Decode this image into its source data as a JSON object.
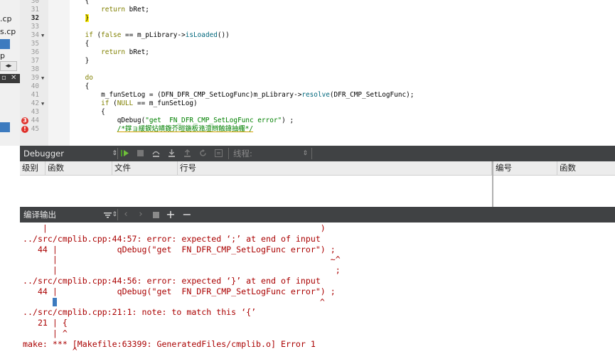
{
  "sidebar": {
    "files": [
      ".cp",
      "s.cp"
    ],
    "item_p": "p",
    "arrow_left": "◂",
    "arrow_right": "▸",
    "close_glyph": "✕"
  },
  "editor": {
    "lines": [
      {
        "n": "30",
        "cur": false,
        "fold": false,
        "err": "",
        "tokens": [
          {
            "c": "plain",
            "t": "    {"
          }
        ]
      },
      {
        "n": "31",
        "cur": false,
        "fold": false,
        "err": "",
        "tokens": [
          {
            "c": "plain",
            "t": "        "
          },
          {
            "c": "kw",
            "t": "return"
          },
          {
            "c": "plain",
            "t": " bRet;"
          }
        ]
      },
      {
        "n": "32",
        "cur": true,
        "fold": false,
        "err": "",
        "tokens": [
          {
            "c": "plain",
            "t": "    "
          },
          {
            "c": "brace-hl",
            "t": "}"
          }
        ]
      },
      {
        "n": "33",
        "cur": false,
        "fold": false,
        "err": "",
        "tokens": []
      },
      {
        "n": "34",
        "cur": false,
        "fold": true,
        "err": "",
        "tokens": [
          {
            "c": "plain",
            "t": "    "
          },
          {
            "c": "kw",
            "t": "if"
          },
          {
            "c": "plain",
            "t": " ("
          },
          {
            "c": "kw",
            "t": "false"
          },
          {
            "c": "plain",
            "t": " == m_pLibrary->"
          },
          {
            "c": "fn",
            "t": "isLoaded"
          },
          {
            "c": "plain",
            "t": "())"
          }
        ]
      },
      {
        "n": "35",
        "cur": false,
        "fold": false,
        "err": "",
        "tokens": [
          {
            "c": "plain",
            "t": "    {"
          }
        ]
      },
      {
        "n": "36",
        "cur": false,
        "fold": false,
        "err": "",
        "tokens": [
          {
            "c": "plain",
            "t": "        "
          },
          {
            "c": "kw",
            "t": "return"
          },
          {
            "c": "plain",
            "t": " bRet;"
          }
        ]
      },
      {
        "n": "37",
        "cur": false,
        "fold": false,
        "err": "",
        "tokens": [
          {
            "c": "plain",
            "t": "    }"
          }
        ]
      },
      {
        "n": "38",
        "cur": false,
        "fold": false,
        "err": "",
        "tokens": []
      },
      {
        "n": "39",
        "cur": false,
        "fold": true,
        "err": "",
        "tokens": [
          {
            "c": "plain",
            "t": "    "
          },
          {
            "c": "kw",
            "t": "do"
          }
        ]
      },
      {
        "n": "40",
        "cur": false,
        "fold": false,
        "err": "",
        "tokens": [
          {
            "c": "plain",
            "t": "    {"
          }
        ]
      },
      {
        "n": "41",
        "cur": false,
        "fold": false,
        "err": "",
        "tokens": [
          {
            "c": "plain",
            "t": "        m_funSetLog = (DFN_DFR_CMP_SetLogFunc)m_pLibrary->"
          },
          {
            "c": "fn",
            "t": "resolve"
          },
          {
            "c": "plain",
            "t": "(DFR_CMP_SetLogFunc);"
          }
        ]
      },
      {
        "n": "42",
        "cur": false,
        "fold": true,
        "err": "",
        "tokens": [
          {
            "c": "plain",
            "t": "        "
          },
          {
            "c": "kw",
            "t": "if"
          },
          {
            "c": "plain",
            "t": " ("
          },
          {
            "c": "kw",
            "t": "NULL"
          },
          {
            "c": "plain",
            "t": " == m_funSetLog)"
          }
        ]
      },
      {
        "n": "43",
        "cur": false,
        "fold": false,
        "err": "",
        "tokens": [
          {
            "c": "plain",
            "t": "        {"
          }
        ]
      },
      {
        "n": "44",
        "cur": false,
        "fold": false,
        "err": "3",
        "tokens": [
          {
            "c": "plain",
            "t": "            qDebug("
          },
          {
            "c": "str",
            "t": "\"get  FN_DFR_CMP_SetLogFunc error\""
          },
          {
            "c": "plain",
            "t": ") ;"
          }
        ]
      },
      {
        "n": "45",
        "cur": false,
        "fold": false,
        "err": "!",
        "tokens": [
          {
            "c": "plain",
            "t": "            "
          },
          {
            "c": "warn",
            "t": "/*鐣ョ緩鍥炶皟鍑芥暟鍦板潃澶辫触鍏抽棴*/"
          }
        ]
      }
    ]
  },
  "debugger": {
    "title": "Debugger",
    "thread_label": "线程:",
    "columns_left": [
      "级别",
      "函数",
      "文件",
      "行号"
    ],
    "columns_right": [
      "编号",
      "函数"
    ]
  },
  "output": {
    "title": "编译输出",
    "add_glyph": "+",
    "remove_glyph": "−",
    "lines": [
      "    |                                                       )",
      "../src/cmplib.cpp:44:57: error: expected ‘;’ at end of input",
      "   44 |            qDebug(\"get  FN_DFR_CMP_SetLogFunc error\") ;",
      "      |                                                       ~^",
      "      |                                                        ;",
      "../src/cmplib.cpp:44:56: error: expected ‘}’ at end of input",
      "   44 |            qDebug(\"get  FN_DFR_CMP_SetLogFunc error\") ;",
      "CURSOR",
      "../src/cmplib.cpp:21:1: note: to match this ‘{’",
      "   21 | {",
      "      | ^",
      "make: *** [Makefile:63399: GeneratedFiles/cmplib.o] Error 1"
    ],
    "last_partial": "          ^"
  }
}
